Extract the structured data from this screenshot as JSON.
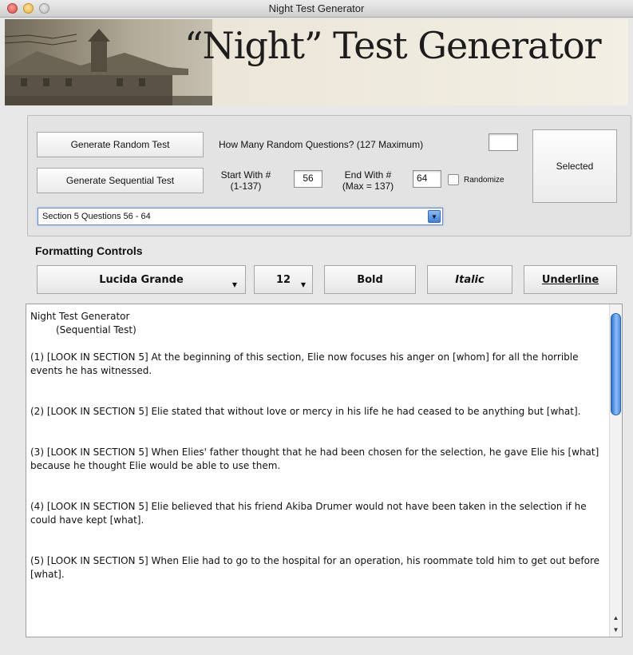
{
  "window": {
    "title": "Night Test Generator"
  },
  "banner": {
    "title": "“Night” Test Generator"
  },
  "controls": {
    "random_button": "Generate Random Test",
    "random_prompt": "How Many Random Questions? (127 Maximum)",
    "random_count_value": "",
    "selected_button": "Selected",
    "sequential_button": "Generate Sequential Test",
    "start_label_1": "Start With #",
    "start_label_2": "(1-137)",
    "start_value": "56",
    "end_label_1": "End With #",
    "end_label_2": "(Max = 137)",
    "end_value": "64",
    "randomize_label": "Randomize",
    "randomize_checked": false,
    "section_select": "Section 5  Questions 56 - 64"
  },
  "formatting": {
    "heading": "Formatting Controls",
    "font": "Lucida Grande",
    "size": "12",
    "bold": "Bold",
    "italic": "Italic",
    "underline": "Underline"
  },
  "output": {
    "title": "Night Test Generator",
    "subtitle": "(Sequential Test)",
    "questions": [
      "(1)  [LOOK IN SECTION 5]   At the beginning of this section, Elie now focuses his anger on [whom] for all the horrible events he has witnessed.",
      "(2)  [LOOK IN SECTION 5]   Elie stated that without love or mercy in his life he had ceased to be anything but [what].",
      "(3)  [LOOK IN SECTION 5]   When Elies' father thought that he had been chosen for the selection, he gave Elie his [what]   because he thought Elie would be able to use them.",
      "(4)  [LOOK IN SECTION 5]   Elie believed that his friend Akiba Drumer would not have been taken in the selection if he could have kept [what].",
      "(5)  [LOOK IN SECTION 5]   When Elie had to go to the hospital for an operation, his roommate told him to get out before [what]."
    ]
  },
  "icons": {
    "close": "close-icon",
    "minimize": "minimize-icon",
    "zoom": "zoom-icon",
    "dropdown": "chevron-down-icon",
    "scroll_up": "scroll-up-icon",
    "scroll_down": "scroll-down-icon"
  }
}
